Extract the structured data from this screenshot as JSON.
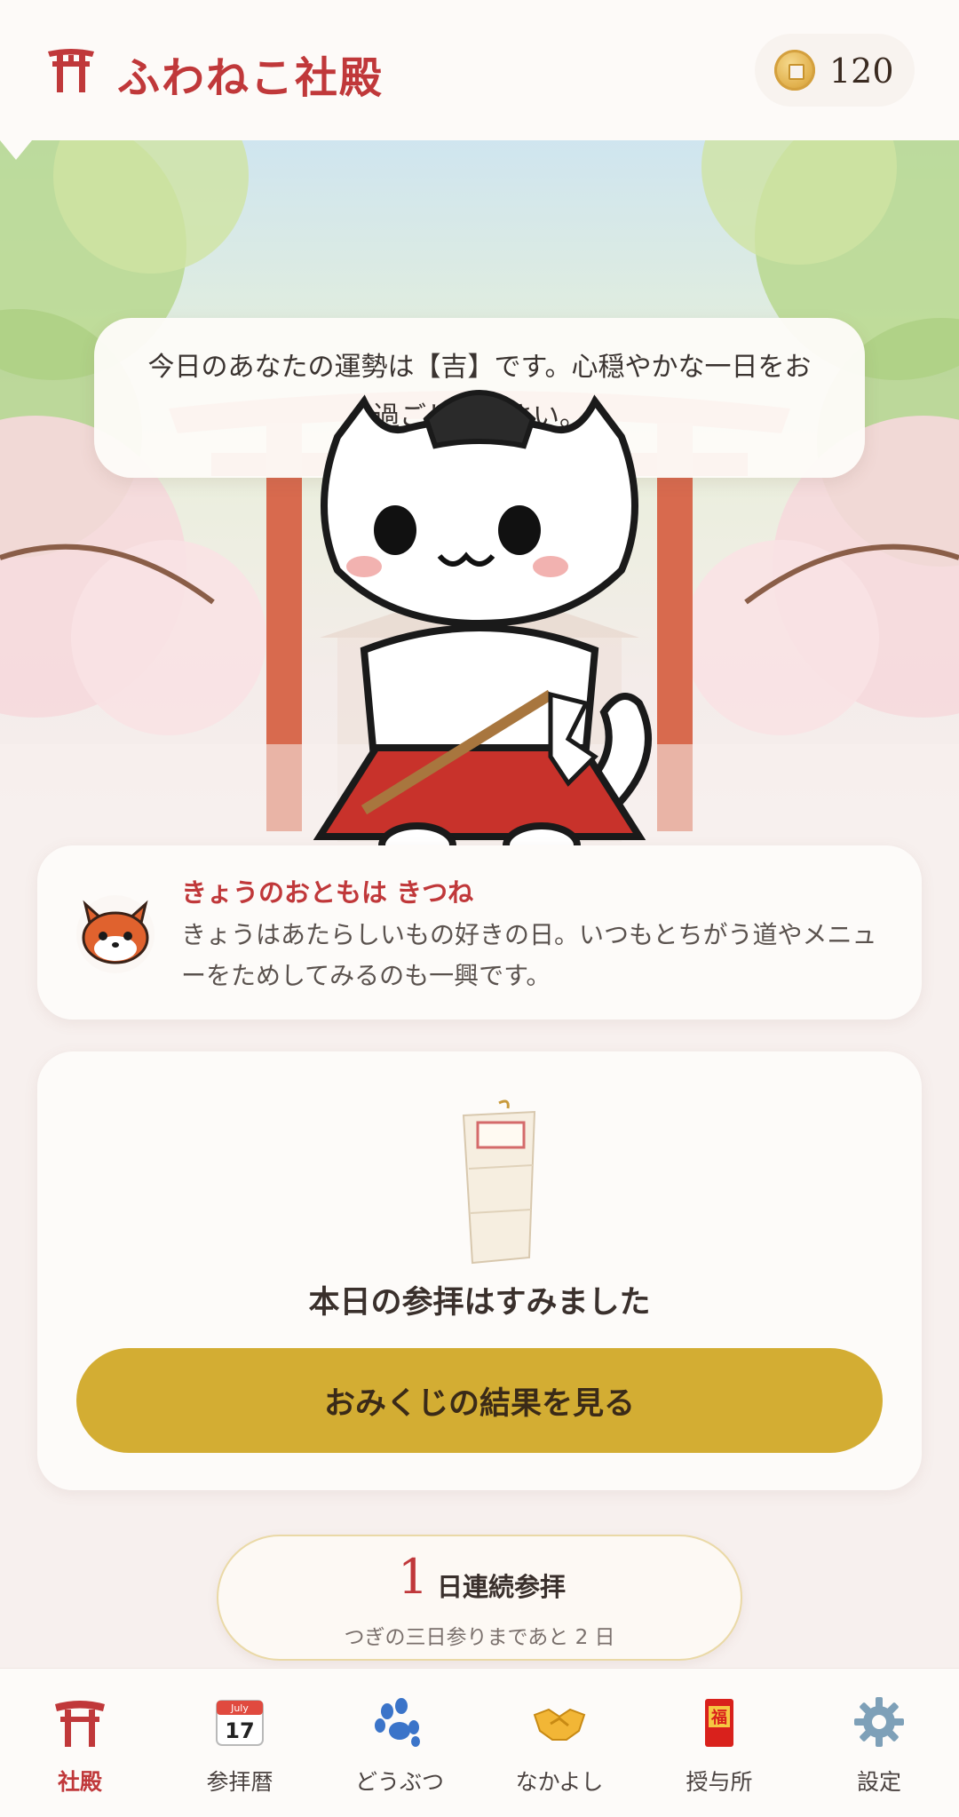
{
  "header": {
    "title": "ふわねこ社殿",
    "coins": "120"
  },
  "hero": {
    "message": "今日のあなたの運勢は【吉】です。心穏やかな一日をお過ごしください。"
  },
  "companion": {
    "title": "きょうのおともは きつね",
    "text": "きょうはあたらしいもの好きの日。いつもとちがう道やメニューをためしてみるのも一興です。"
  },
  "visit": {
    "status": "本日の参拝はすみました",
    "button_label": "おみくじの結果を見る"
  },
  "streak": {
    "count": "1",
    "label": "日連続参拝",
    "sub": "つぎの三日参りまであと 2 日"
  },
  "nav": {
    "items": [
      {
        "label": "社殿",
        "icon": "torii-icon",
        "active": true
      },
      {
        "label": "参拝暦",
        "icon": "calendar-icon",
        "month": "July",
        "day": "17"
      },
      {
        "label": "どうぶつ",
        "icon": "paw-icon"
      },
      {
        "label": "なかよし",
        "icon": "handshake-icon"
      },
      {
        "label": "授与所",
        "icon": "charm-icon",
        "charm_char": "福"
      },
      {
        "label": "設定",
        "icon": "gear-icon"
      }
    ]
  },
  "colors": {
    "accent": "#c0383a",
    "button": "#d3ad33",
    "background": "#f7f0ee"
  }
}
